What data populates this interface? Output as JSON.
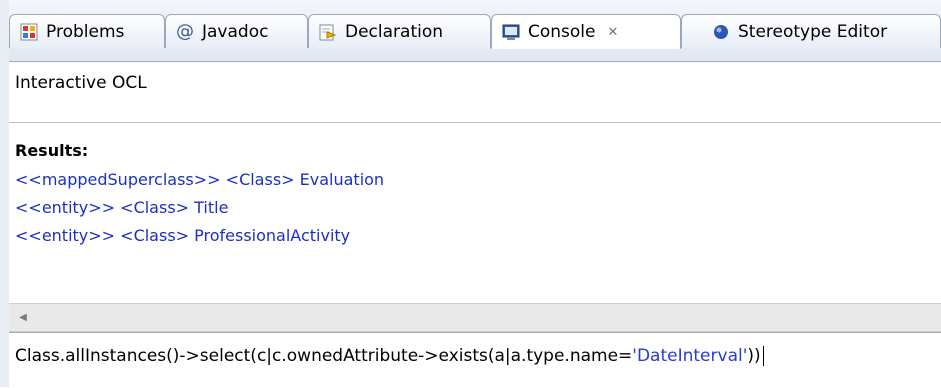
{
  "tabs": [
    {
      "label": "Problems",
      "icon": "problems-icon"
    },
    {
      "label": "Javadoc",
      "icon": "at-sign-icon"
    },
    {
      "label": "Declaration",
      "icon": "declaration-icon"
    },
    {
      "label": "Console",
      "icon": "console-icon",
      "active": true,
      "close": "✕"
    },
    {
      "label": "Stereotype Editor",
      "icon": "stereotype-icon"
    }
  ],
  "console": {
    "title": "Interactive OCL",
    "results_heading": "Results:",
    "results": [
      "<<mappedSuperclass>> <Class> Evaluation",
      "<<entity>> <Class> Title",
      "<<entity>> <Class> ProfessionalActivity"
    ],
    "input_prefix": "Class.allInstances()->select(c|c.ownedAttribute->exists(a|a.type.name=",
    "input_string": "'DateInterval'",
    "input_suffix": "))"
  },
  "colors": {
    "result_text": "#1b2fc7",
    "string_literal": "#2a3bd1",
    "tab_border": "#9aa9bd"
  }
}
